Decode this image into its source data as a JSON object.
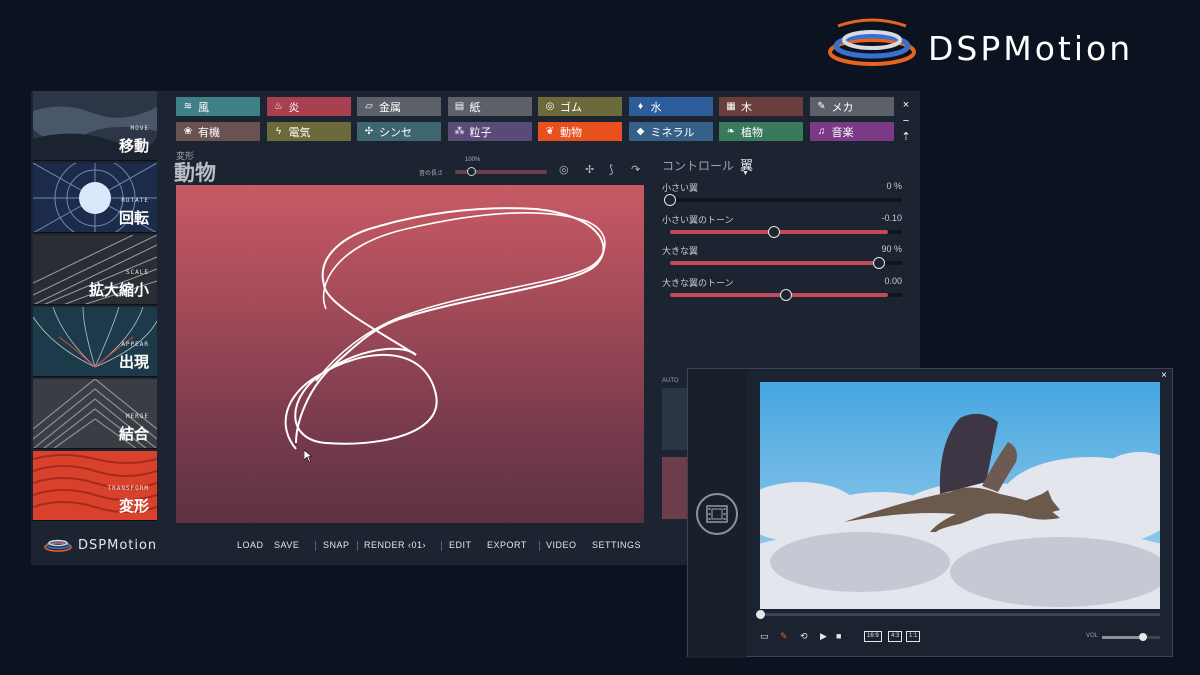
{
  "brand": {
    "name": "DSPMotion"
  },
  "sidebar": {
    "items": [
      {
        "en": "MOVE",
        "jp": "移動"
      },
      {
        "en": "ROTATE",
        "jp": "回転"
      },
      {
        "en": "SCALE",
        "jp": "拡大縮小"
      },
      {
        "en": "APPEAR",
        "jp": "出現"
      },
      {
        "en": "MERGE",
        "jp": "結合"
      },
      {
        "en": "TRANSFORM",
        "jp": "変形"
      }
    ],
    "selected": "TRANSFORM"
  },
  "categories": [
    {
      "label": "風",
      "icon": "wind-icon",
      "glyph": "≋",
      "color": "#3f7f86"
    },
    {
      "label": "炎",
      "icon": "flame-icon",
      "glyph": "♨",
      "color": "#a8404f"
    },
    {
      "label": "金属",
      "icon": "metal-icon",
      "glyph": "▱",
      "color": "#5c6068"
    },
    {
      "label": "紙",
      "icon": "paper-icon",
      "glyph": "▤",
      "color": "#5c6068"
    },
    {
      "label": "ゴム",
      "icon": "rubber-icon",
      "glyph": "◎",
      "color": "#6c6a3a"
    },
    {
      "label": "水",
      "icon": "water-icon",
      "glyph": "♦",
      "color": "#2d5c9b"
    },
    {
      "label": "木",
      "icon": "wood-icon",
      "glyph": "▦",
      "color": "#6b3e3e"
    },
    {
      "label": "メカ",
      "icon": "wrench-icon",
      "glyph": "✎",
      "color": "#5c6068"
    },
    {
      "label": "有機",
      "icon": "organic-icon",
      "glyph": "❀",
      "color": "#6b5252"
    },
    {
      "label": "電気",
      "icon": "lightning-icon",
      "glyph": "ϟ",
      "color": "#6c6a3a"
    },
    {
      "label": "シンセ",
      "icon": "synth-icon",
      "glyph": "✣",
      "color": "#3d6670"
    },
    {
      "label": "粒子",
      "icon": "particle-icon",
      "glyph": "⁂",
      "color": "#5a4a78"
    },
    {
      "label": "動物",
      "icon": "paw-icon",
      "glyph": "❦",
      "color": "#e8501e"
    },
    {
      "label": "ミネラル",
      "icon": "mineral-icon",
      "glyph": "◆",
      "color": "#36608a"
    },
    {
      "label": "植物",
      "icon": "plant-icon",
      "glyph": "❧",
      "color": "#3a7a5c"
    },
    {
      "label": "音楽",
      "icon": "music-icon",
      "glyph": "♫",
      "color": "#7a3a86"
    }
  ],
  "main": {
    "subtitle": "変形",
    "title": "動物",
    "param": {
      "label": "音の長さ",
      "value": "100%"
    }
  },
  "control": {
    "title": "コントロール",
    "selected": "翼",
    "sliders": [
      {
        "label": "小さい翼",
        "value": "0 %",
        "fraction": 0.0
      },
      {
        "label": "小さい翼のトーン",
        "value": "-0.10",
        "fraction": 0.45
      },
      {
        "label": "大きな翼",
        "value": "90 %",
        "fraction": 0.9
      },
      {
        "label": "大きな翼のトーン",
        "value": "0.00",
        "fraction": 0.5
      }
    ],
    "auto_label": "AUTO"
  },
  "bottom_bar": {
    "brand": "DSPMotion",
    "menu": [
      "LOAD",
      "SAVE",
      "SNAP",
      "RENDER ‹01›",
      "EDIT",
      "EXPORT",
      "VIDEO",
      "SETTINGS"
    ]
  },
  "video": {
    "close": "×",
    "progress": 0.0,
    "buttons": {
      "ratio1": "16:9",
      "ratio2": "4:3",
      "ratio3": "1:1"
    },
    "volume_label": "VOL",
    "volume": 0.7
  },
  "window": {
    "close": "×",
    "minimize": "−",
    "pin": "⇡"
  }
}
